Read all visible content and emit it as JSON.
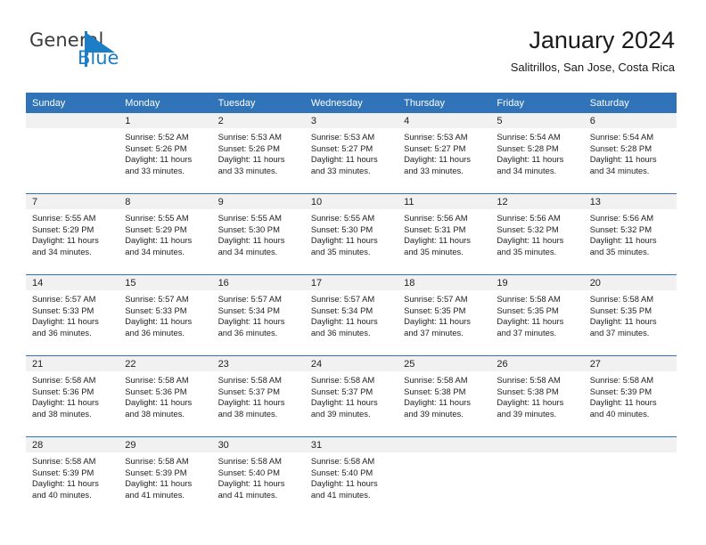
{
  "brand": {
    "name_top": "General",
    "name_bottom": "Blue",
    "accent_color": "#1d7ec8",
    "logo_icon": "triangle-flag-icon"
  },
  "header": {
    "title": "January 2024",
    "subtitle": "Salitrillos, San Jose, Costa Rica"
  },
  "theme": {
    "header_blue": "#3073b8",
    "daynum_band": "#f1f1f1",
    "text": "#222222"
  },
  "calendar": {
    "weekday_headers": [
      "Sunday",
      "Monday",
      "Tuesday",
      "Wednesday",
      "Thursday",
      "Friday",
      "Saturday"
    ],
    "labels": {
      "sunrise": "Sunrise:",
      "sunset": "Sunset:",
      "daylight": "Daylight:"
    },
    "weeks": [
      [
        {
          "day": "",
          "sunrise": "",
          "sunset": "",
          "daylight": ""
        },
        {
          "day": "1",
          "sunrise": "Sunrise: 5:52 AM",
          "sunset": "Sunset: 5:26 PM",
          "daylight": "Daylight: 11 hours and 33 minutes."
        },
        {
          "day": "2",
          "sunrise": "Sunrise: 5:53 AM",
          "sunset": "Sunset: 5:26 PM",
          "daylight": "Daylight: 11 hours and 33 minutes."
        },
        {
          "day": "3",
          "sunrise": "Sunrise: 5:53 AM",
          "sunset": "Sunset: 5:27 PM",
          "daylight": "Daylight: 11 hours and 33 minutes."
        },
        {
          "day": "4",
          "sunrise": "Sunrise: 5:53 AM",
          "sunset": "Sunset: 5:27 PM",
          "daylight": "Daylight: 11 hours and 33 minutes."
        },
        {
          "day": "5",
          "sunrise": "Sunrise: 5:54 AM",
          "sunset": "Sunset: 5:28 PM",
          "daylight": "Daylight: 11 hours and 34 minutes."
        },
        {
          "day": "6",
          "sunrise": "Sunrise: 5:54 AM",
          "sunset": "Sunset: 5:28 PM",
          "daylight": "Daylight: 11 hours and 34 minutes."
        }
      ],
      [
        {
          "day": "7",
          "sunrise": "Sunrise: 5:55 AM",
          "sunset": "Sunset: 5:29 PM",
          "daylight": "Daylight: 11 hours and 34 minutes."
        },
        {
          "day": "8",
          "sunrise": "Sunrise: 5:55 AM",
          "sunset": "Sunset: 5:29 PM",
          "daylight": "Daylight: 11 hours and 34 minutes."
        },
        {
          "day": "9",
          "sunrise": "Sunrise: 5:55 AM",
          "sunset": "Sunset: 5:30 PM",
          "daylight": "Daylight: 11 hours and 34 minutes."
        },
        {
          "day": "10",
          "sunrise": "Sunrise: 5:55 AM",
          "sunset": "Sunset: 5:30 PM",
          "daylight": "Daylight: 11 hours and 35 minutes."
        },
        {
          "day": "11",
          "sunrise": "Sunrise: 5:56 AM",
          "sunset": "Sunset: 5:31 PM",
          "daylight": "Daylight: 11 hours and 35 minutes."
        },
        {
          "day": "12",
          "sunrise": "Sunrise: 5:56 AM",
          "sunset": "Sunset: 5:32 PM",
          "daylight": "Daylight: 11 hours and 35 minutes."
        },
        {
          "day": "13",
          "sunrise": "Sunrise: 5:56 AM",
          "sunset": "Sunset: 5:32 PM",
          "daylight": "Daylight: 11 hours and 35 minutes."
        }
      ],
      [
        {
          "day": "14",
          "sunrise": "Sunrise: 5:57 AM",
          "sunset": "Sunset: 5:33 PM",
          "daylight": "Daylight: 11 hours and 36 minutes."
        },
        {
          "day": "15",
          "sunrise": "Sunrise: 5:57 AM",
          "sunset": "Sunset: 5:33 PM",
          "daylight": "Daylight: 11 hours and 36 minutes."
        },
        {
          "day": "16",
          "sunrise": "Sunrise: 5:57 AM",
          "sunset": "Sunset: 5:34 PM",
          "daylight": "Daylight: 11 hours and 36 minutes."
        },
        {
          "day": "17",
          "sunrise": "Sunrise: 5:57 AM",
          "sunset": "Sunset: 5:34 PM",
          "daylight": "Daylight: 11 hours and 36 minutes."
        },
        {
          "day": "18",
          "sunrise": "Sunrise: 5:57 AM",
          "sunset": "Sunset: 5:35 PM",
          "daylight": "Daylight: 11 hours and 37 minutes."
        },
        {
          "day": "19",
          "sunrise": "Sunrise: 5:58 AM",
          "sunset": "Sunset: 5:35 PM",
          "daylight": "Daylight: 11 hours and 37 minutes."
        },
        {
          "day": "20",
          "sunrise": "Sunrise: 5:58 AM",
          "sunset": "Sunset: 5:35 PM",
          "daylight": "Daylight: 11 hours and 37 minutes."
        }
      ],
      [
        {
          "day": "21",
          "sunrise": "Sunrise: 5:58 AM",
          "sunset": "Sunset: 5:36 PM",
          "daylight": "Daylight: 11 hours and 38 minutes."
        },
        {
          "day": "22",
          "sunrise": "Sunrise: 5:58 AM",
          "sunset": "Sunset: 5:36 PM",
          "daylight": "Daylight: 11 hours and 38 minutes."
        },
        {
          "day": "23",
          "sunrise": "Sunrise: 5:58 AM",
          "sunset": "Sunset: 5:37 PM",
          "daylight": "Daylight: 11 hours and 38 minutes."
        },
        {
          "day": "24",
          "sunrise": "Sunrise: 5:58 AM",
          "sunset": "Sunset: 5:37 PM",
          "daylight": "Daylight: 11 hours and 39 minutes."
        },
        {
          "day": "25",
          "sunrise": "Sunrise: 5:58 AM",
          "sunset": "Sunset: 5:38 PM",
          "daylight": "Daylight: 11 hours and 39 minutes."
        },
        {
          "day": "26",
          "sunrise": "Sunrise: 5:58 AM",
          "sunset": "Sunset: 5:38 PM",
          "daylight": "Daylight: 11 hours and 39 minutes."
        },
        {
          "day": "27",
          "sunrise": "Sunrise: 5:58 AM",
          "sunset": "Sunset: 5:39 PM",
          "daylight": "Daylight: 11 hours and 40 minutes."
        }
      ],
      [
        {
          "day": "28",
          "sunrise": "Sunrise: 5:58 AM",
          "sunset": "Sunset: 5:39 PM",
          "daylight": "Daylight: 11 hours and 40 minutes."
        },
        {
          "day": "29",
          "sunrise": "Sunrise: 5:58 AM",
          "sunset": "Sunset: 5:39 PM",
          "daylight": "Daylight: 11 hours and 41 minutes."
        },
        {
          "day": "30",
          "sunrise": "Sunrise: 5:58 AM",
          "sunset": "Sunset: 5:40 PM",
          "daylight": "Daylight: 11 hours and 41 minutes."
        },
        {
          "day": "31",
          "sunrise": "Sunrise: 5:58 AM",
          "sunset": "Sunset: 5:40 PM",
          "daylight": "Daylight: 11 hours and 41 minutes."
        },
        {
          "day": "",
          "sunrise": "",
          "sunset": "",
          "daylight": ""
        },
        {
          "day": "",
          "sunrise": "",
          "sunset": "",
          "daylight": ""
        },
        {
          "day": "",
          "sunrise": "",
          "sunset": "",
          "daylight": ""
        }
      ]
    ]
  }
}
